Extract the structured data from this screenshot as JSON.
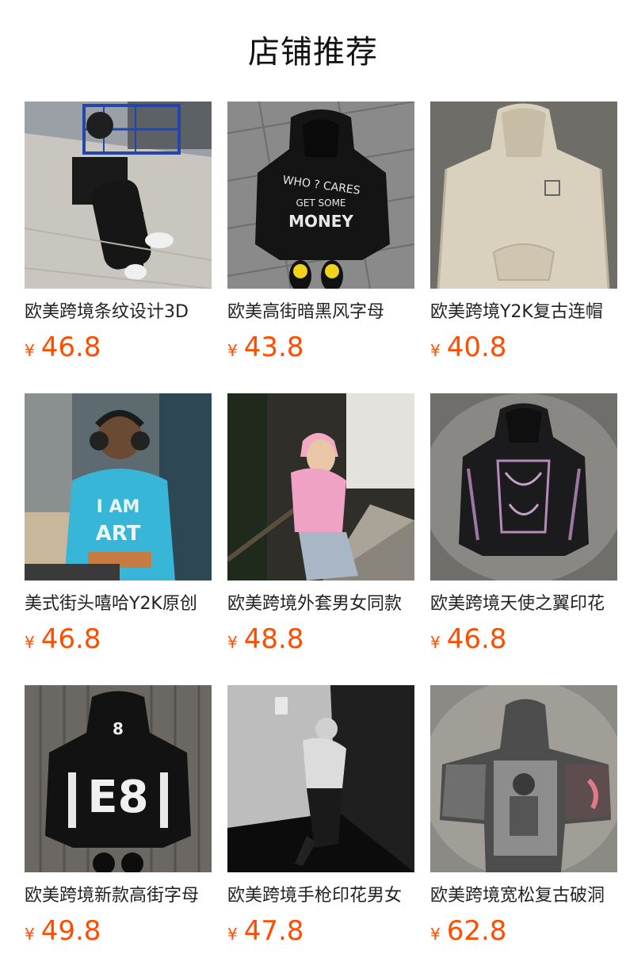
{
  "section": {
    "title": "店铺推荐"
  },
  "currency_symbol": "¥",
  "colors": {
    "price": "#ff4d00",
    "title": "#111111"
  },
  "products": [
    {
      "name": "欧美跨境条纹设计3D",
      "price": "46.8",
      "image": "person-sitting-on-shopping-cart-photo"
    },
    {
      "name": "欧美高街暗黑风字母",
      "price": "43.8",
      "image": "black-who-cares-money-hoodie-photo"
    },
    {
      "name": "欧美跨境Y2K复古连帽",
      "price": "40.8",
      "image": "beige-hoodie-photo"
    },
    {
      "name": "美式街头嘻哈Y2K原创",
      "price": "46.8",
      "image": "man-in-blue-graphic-hoodie-photo"
    },
    {
      "name": "欧美跨境外套男女同款",
      "price": "48.8",
      "image": "woman-in-pink-hoodie-photo"
    },
    {
      "name": "欧美跨境天使之翼印花",
      "price": "46.8",
      "image": "black-angel-print-hoodie-photo"
    },
    {
      "name": "欧美跨境新款高街字母",
      "price": "49.8",
      "image": "black-e8-graphic-hoodie-photo"
    },
    {
      "name": "欧美跨境手枪印花男女",
      "price": "47.8",
      "image": "person-in-hallway-photo"
    },
    {
      "name": "欧美跨境宽松复古破洞",
      "price": "62.8",
      "image": "photo-print-hoodie-photo"
    }
  ]
}
